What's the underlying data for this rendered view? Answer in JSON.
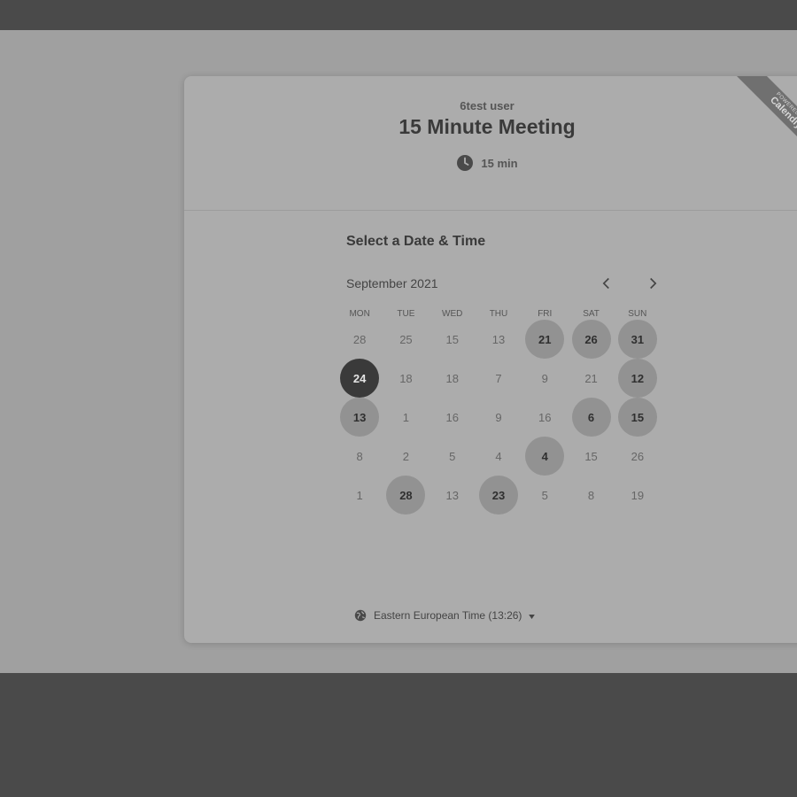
{
  "event": {
    "host": "6test user",
    "title": "15 Minute Meeting",
    "duration": "15 min"
  },
  "badge": {
    "small": "POWERED BY",
    "brand": "Calendly"
  },
  "scheduler": {
    "section_title": "Select a Date & Time",
    "month_label": "September 2021",
    "prev_icon": "chevron-left-icon",
    "next_icon": "chevron-right-icon",
    "weekdays": [
      "MON",
      "TUE",
      "WED",
      "THU",
      "FRI",
      "SAT",
      "SUN"
    ],
    "weeks": [
      [
        {
          "label": "28",
          "state": "unavailable"
        },
        {
          "label": "25",
          "state": "unavailable"
        },
        {
          "label": "15",
          "state": "unavailable"
        },
        {
          "label": "13",
          "state": "unavailable"
        },
        {
          "label": "21",
          "state": "available"
        },
        {
          "label": "26",
          "state": "available"
        },
        {
          "label": "31",
          "state": "available"
        }
      ],
      [
        {
          "label": "24",
          "state": "selected"
        },
        {
          "label": "18",
          "state": "unavailable"
        },
        {
          "label": "18",
          "state": "unavailable"
        },
        {
          "label": "7",
          "state": "unavailable"
        },
        {
          "label": "9",
          "state": "unavailable"
        },
        {
          "label": "21",
          "state": "unavailable"
        },
        {
          "label": "12",
          "state": "available"
        }
      ],
      [
        {
          "label": "13",
          "state": "available"
        },
        {
          "label": "1",
          "state": "unavailable"
        },
        {
          "label": "16",
          "state": "unavailable"
        },
        {
          "label": "9",
          "state": "unavailable"
        },
        {
          "label": "16",
          "state": "unavailable"
        },
        {
          "label": "6",
          "state": "available"
        },
        {
          "label": "15",
          "state": "available"
        }
      ],
      [
        {
          "label": "8",
          "state": "unavailable"
        },
        {
          "label": "2",
          "state": "unavailable"
        },
        {
          "label": "5",
          "state": "unavailable"
        },
        {
          "label": "4",
          "state": "unavailable"
        },
        {
          "label": "4",
          "state": "available"
        },
        {
          "label": "15",
          "state": "unavailable"
        },
        {
          "label": "26",
          "state": "unavailable"
        }
      ],
      [
        {
          "label": "1",
          "state": "unavailable"
        },
        {
          "label": "28",
          "state": "available"
        },
        {
          "label": "13",
          "state": "unavailable"
        },
        {
          "label": "23",
          "state": "available"
        },
        {
          "label": "5",
          "state": "unavailable"
        },
        {
          "label": "8",
          "state": "unavailable"
        },
        {
          "label": "19",
          "state": "unavailable"
        }
      ]
    ],
    "timezone": "Eastern European Time (13:26)",
    "timezone_icon": "globe-icon"
  },
  "colors": {
    "selected_day": "#3a3a3a",
    "available_day": "#929292"
  }
}
